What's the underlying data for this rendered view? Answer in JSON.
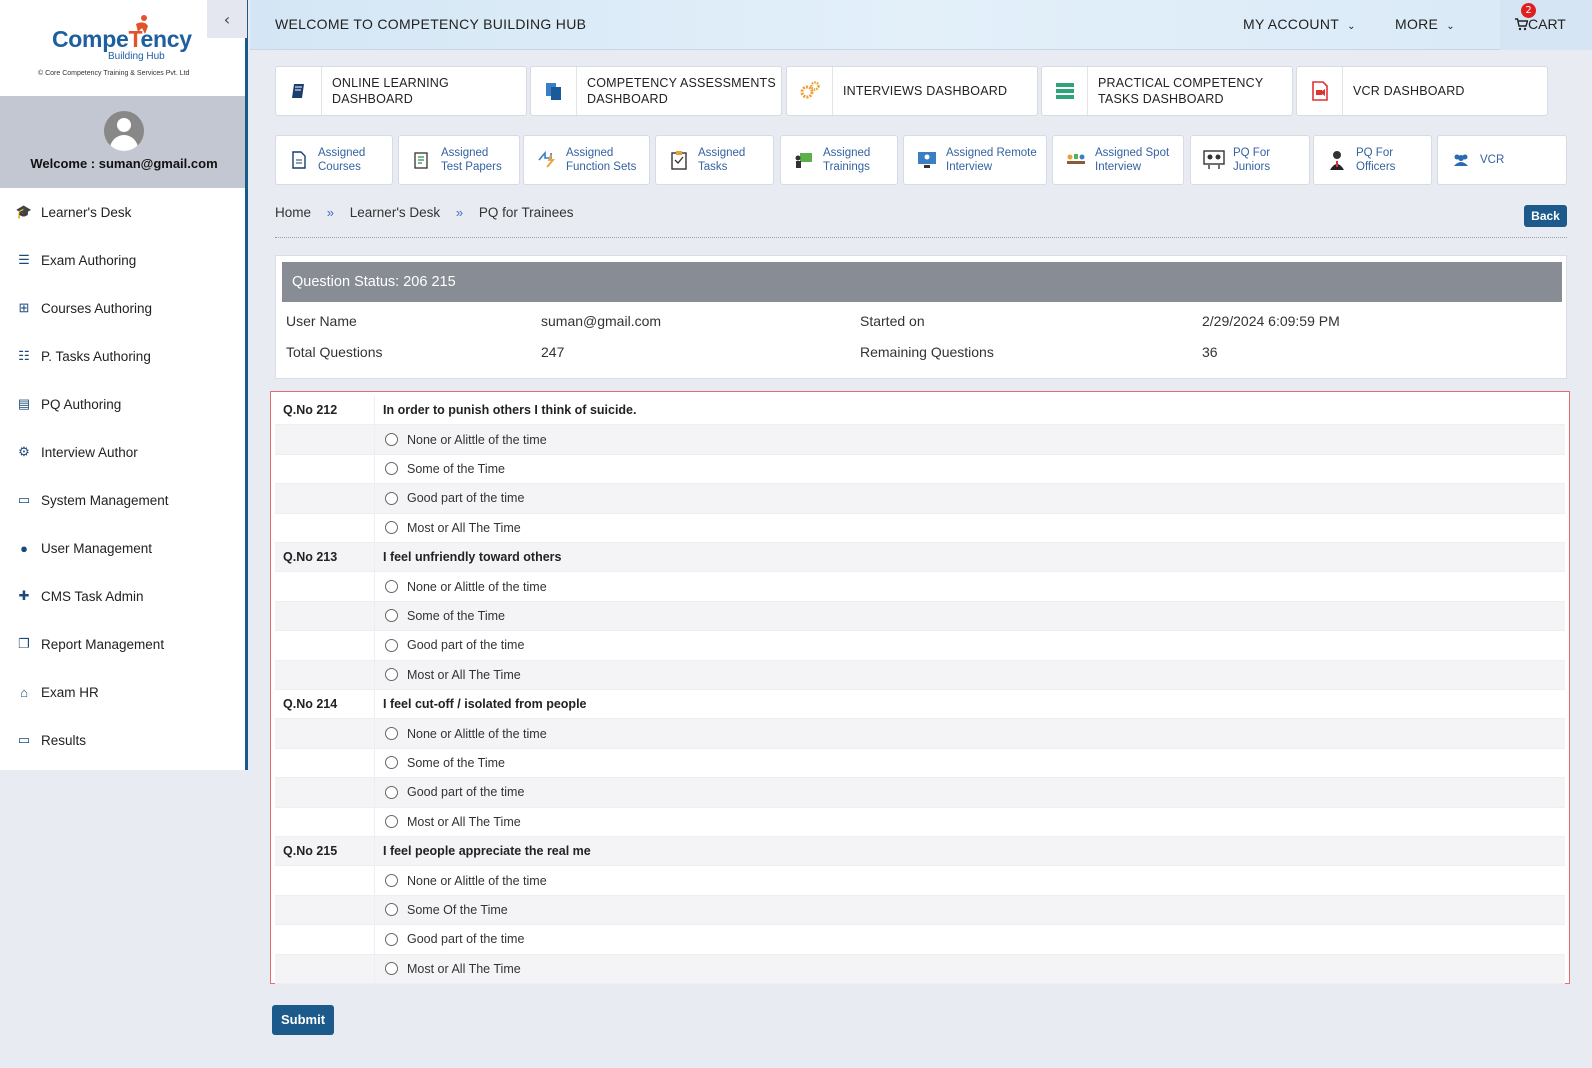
{
  "sidebar": {
    "logo_main_a": "Compe",
    "logo_main_t": "T",
    "logo_main_b": "ency",
    "logo_sub": "Building Hub",
    "logo_copy": "© Core Competency Training & Services Pvt. Ltd",
    "collapse_icon": "‹",
    "welcome": "Welcome : suman@gmail.com",
    "items": [
      {
        "label": "Learner's Desk",
        "icon": "graduation-cap-icon",
        "glyph": "🎓"
      },
      {
        "label": "Exam Authoring",
        "icon": "list-icon",
        "glyph": "☰"
      },
      {
        "label": "Courses Authoring",
        "icon": "sitemap-icon",
        "glyph": "⊞"
      },
      {
        "label": "P. Tasks Authoring",
        "icon": "tasks-icon",
        "glyph": "☷"
      },
      {
        "label": "PQ Authoring",
        "icon": "book-icon",
        "glyph": "▤"
      },
      {
        "label": "Interview Author",
        "icon": "cogs-icon",
        "glyph": "⚙"
      },
      {
        "label": "System Management",
        "icon": "desktop-icon",
        "glyph": "▭"
      },
      {
        "label": "User Management",
        "icon": "user-icon",
        "glyph": "●"
      },
      {
        "label": "CMS Task Admin",
        "icon": "user-plus-icon",
        "glyph": "✚"
      },
      {
        "label": "Report Management",
        "icon": "copy-icon",
        "glyph": "❐"
      },
      {
        "label": "Exam HR",
        "icon": "university-icon",
        "glyph": "⌂"
      },
      {
        "label": "Results",
        "icon": "desktop-icon",
        "glyph": "▭"
      }
    ]
  },
  "header": {
    "title": "WELCOME TO COMPETENCY BUILDING HUB",
    "my_account": "MY ACCOUNT",
    "more": "MORE",
    "cart": "CART",
    "cart_count": "2",
    "chevron": "⌄"
  },
  "dashboards": [
    {
      "label1": "ONLINE LEARNING",
      "label2": "DASHBOARD",
      "icon": "book-icon"
    },
    {
      "label1": "COMPETENCY ASSESSMENTS",
      "label2": "DASHBOARD",
      "icon": "copy-icon"
    },
    {
      "label1": "INTERVIEWS DASHBOARD",
      "label2": "",
      "icon": "cogs-icon"
    },
    {
      "label1": "PRACTICAL COMPETENCY",
      "label2": "TASKS DASHBOARD",
      "icon": "server-icon"
    },
    {
      "label1": "VCR DASHBOARD",
      "label2": "",
      "icon": "video-file-icon"
    }
  ],
  "assigned": [
    {
      "label1": "Assigned",
      "label2": "Courses",
      "icon": "document-icon"
    },
    {
      "label1": "Assigned",
      "label2": "Test Papers",
      "icon": "test-paper-icon"
    },
    {
      "label1": "Assigned",
      "label2": "Function Sets",
      "icon": "function-icon"
    },
    {
      "label1": "Assigned",
      "label2": "Tasks",
      "icon": "clipboard-icon"
    },
    {
      "label1": "Assigned",
      "label2": "Trainings",
      "icon": "training-icon"
    },
    {
      "label1": "Assigned Remote",
      "label2": "Interview",
      "icon": "remote-interview-icon"
    },
    {
      "label1": "Assigned Spot",
      "label2": "Interview",
      "icon": "spot-interview-icon"
    },
    {
      "label1": "PQ For",
      "label2": "Juniors",
      "icon": "juniors-icon"
    },
    {
      "label1": "PQ For",
      "label2": "Officers",
      "icon": "officer-icon"
    },
    {
      "label1": "VCR",
      "label2": "",
      "icon": "users-icon"
    }
  ],
  "breadcrumb": {
    "home": "Home",
    "learners_desk": "Learner's Desk",
    "current": "PQ for Trainees",
    "sep": "»",
    "back": "Back"
  },
  "status": {
    "heading": "Question Status: 206 215",
    "user_name_label": "User Name",
    "user_name": "suman@gmail.com",
    "started_on_label": "Started on",
    "started_on": "2/29/2024 6:09:59 PM",
    "total_label": "Total Questions",
    "total": "247",
    "remaining_label": "Remaining Questions",
    "remaining": "36"
  },
  "questions": [
    {
      "no": "Q.No 212",
      "text": "In order to punish others I think of suicide.",
      "options": [
        "None or Alittle of the time",
        "Some of the Time",
        "Good part of the time",
        "Most or All The Time"
      ]
    },
    {
      "no": "Q.No 213",
      "text": "I feel unfriendly toward others",
      "options": [
        "None or Alittle of the time",
        "Some of the Time",
        "Good part of the time",
        "Most or All The Time"
      ]
    },
    {
      "no": "Q.No 214",
      "text": "I feel cut-off / isolated from people",
      "options": [
        "None or Alittle of the time",
        "Some of the Time",
        "Good part of the time",
        "Most or All The Time"
      ]
    },
    {
      "no": "Q.No 215",
      "text": "I feel people appreciate the real me",
      "options": [
        "None or Alittle of the time",
        "Some Of the Time",
        "Good part of the time",
        "Most or All The Time"
      ]
    }
  ],
  "submit": "Submit",
  "colors": {
    "primary": "#1b5a8a",
    "status_head": "#878c95",
    "badge": "#e02020"
  }
}
